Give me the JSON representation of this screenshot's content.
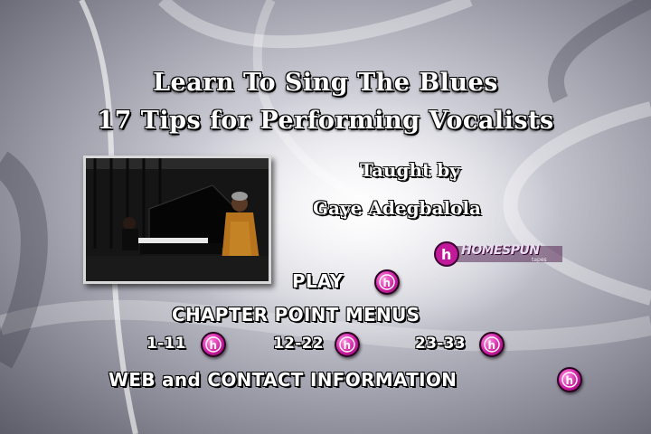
{
  "header": {
    "title_line1": "Learn To Sing The Blues",
    "title_line2": "17 Tips for Performing Vocalists",
    "taught_by": "Taught by",
    "instructor": "Gaye Adegbalola"
  },
  "logo": {
    "brand": "HOMESPUN",
    "tagline": "tapes"
  },
  "menu": {
    "play_label": "PLAY",
    "chapter_heading": "CHAPTER POINT MENUS",
    "chapters": [
      "1-11",
      "12-22",
      "23-33"
    ],
    "web_label": "WEB and CONTACT INFORMATION"
  },
  "colors": {
    "button_accent": "#d21ea6",
    "text": "#ffffff",
    "outline": "#000000"
  },
  "icons": {
    "menu_button": "homespun-h-icon"
  }
}
